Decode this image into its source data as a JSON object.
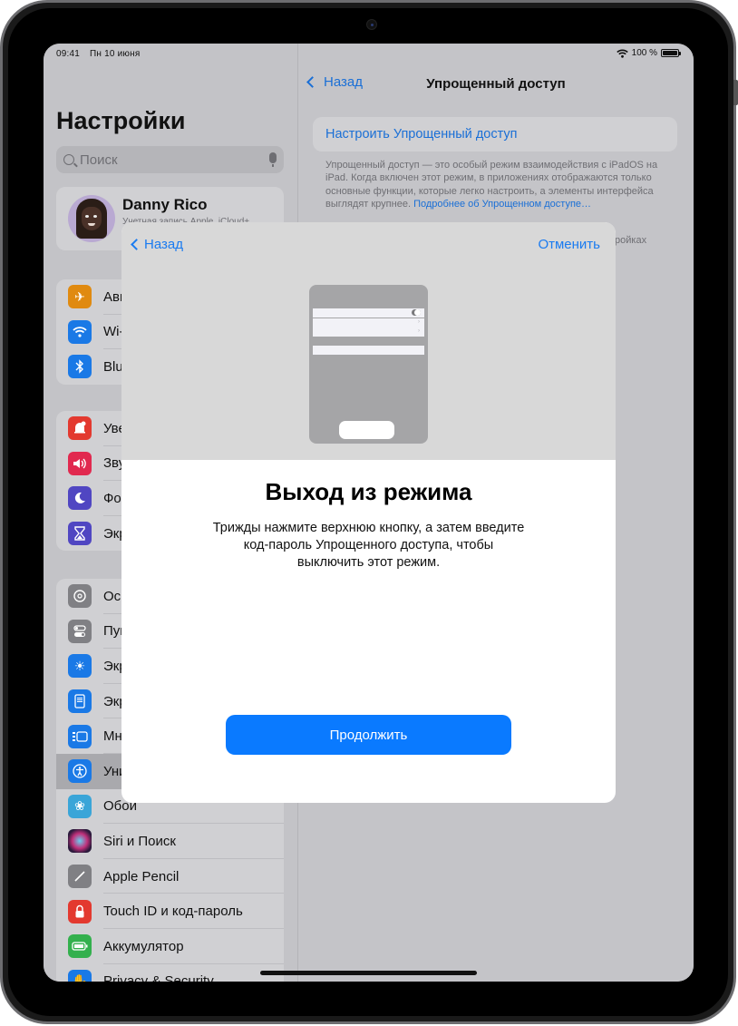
{
  "status_bar": {
    "time": "09:41",
    "date": "Пн 10 июня",
    "battery_text": "100 %",
    "wifi_icon": "wifi-icon",
    "battery_icon": "battery-full-icon"
  },
  "sidebar": {
    "title": "Настройки",
    "search_placeholder": "Поиск",
    "profile": {
      "name": "Danny Rico",
      "subtitle": "Учетная запись Apple, iCloud+"
    },
    "groups": [
      {
        "items": [
          {
            "label": "Авиарежим",
            "icon": "airplane-icon",
            "color": "#e08a10"
          },
          {
            "label": "Wi-Fi",
            "icon": "wifi-icon",
            "color": "#1a79e6"
          },
          {
            "label": "Bluetooth",
            "icon": "bluetooth-icon",
            "color": "#1a79e6"
          }
        ]
      },
      {
        "items": [
          {
            "label": "Уведомления",
            "icon": "notifications-icon",
            "color": "#e3392f"
          },
          {
            "label": "Звуки",
            "icon": "sound-icon",
            "color": "#e1294f"
          },
          {
            "label": "Фокусирование",
            "icon": "moon-icon",
            "color": "#5046c2"
          },
          {
            "label": "Экранное время",
            "icon": "hourglass-icon",
            "color": "#5046c2"
          }
        ]
      },
      {
        "items": [
          {
            "label": "Основные",
            "icon": "gear-icon",
            "color": "#808084"
          },
          {
            "label": "Пункт управления",
            "icon": "toggles-icon",
            "color": "#808084"
          },
          {
            "label": "Экран и яркость",
            "icon": "brightness-icon",
            "color": "#1a79e6"
          },
          {
            "label": "Экран «Домой»",
            "icon": "home-screen-icon",
            "color": "#1a79e6"
          },
          {
            "label": "Многозадачность",
            "icon": "multitasking-icon",
            "color": "#1a79e6"
          },
          {
            "label": "Универсальный доступ",
            "icon": "accessibility-icon",
            "color": "#1a79e6",
            "selected": true
          },
          {
            "label": "Обои",
            "icon": "wallpaper-icon",
            "color": "#3aa5d8"
          },
          {
            "label": "Siri и Поиск",
            "icon": "siri-icon",
            "color": "#2b1a3c"
          },
          {
            "label": "Apple Pencil",
            "icon": "pencil-icon",
            "color": "#808084"
          },
          {
            "label": "Touch ID и код-пароль",
            "icon": "lock-icon",
            "color": "#e3392f"
          },
          {
            "label": "Аккумулятор",
            "icon": "battery-icon",
            "color": "#33b04d"
          },
          {
            "label": "Privacy & Security",
            "icon": "hand-icon",
            "color": "#1a79e6"
          }
        ]
      }
    ]
  },
  "detail": {
    "back_label": "Назад",
    "title": "Упрощенный доступ",
    "setup_label": "Настроить Упрощенный доступ",
    "description": "Упрощенный доступ — это особый режим взаимодействия с iPadOS на iPad. Когда включен этот режим, в приложениях отображаются только основные функции, которые легко настроить, а элементы интерфейса выглядят крупнее.",
    "learn_more": "Подробнее об Упрощенном доступе…",
    "partial_text": "тройках"
  },
  "modal": {
    "back_label": "Назад",
    "cancel_label": "Отменить",
    "heading": "Выход из режима",
    "body": "Трижды нажмите верхнюю кнопку, а затем введите код-пароль Упрощенного доступа, чтобы выключить этот режим.",
    "continue_label": "Продолжить",
    "accent_color": "#0a7aff"
  }
}
